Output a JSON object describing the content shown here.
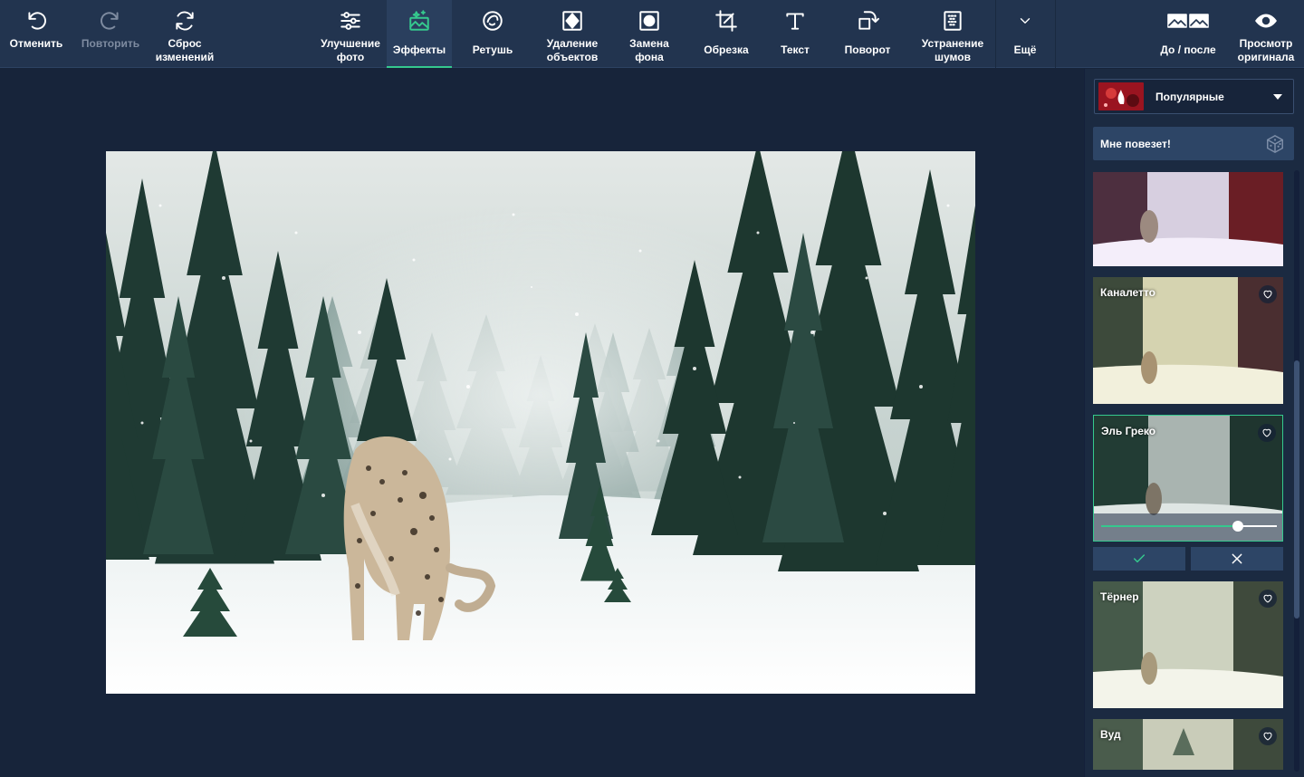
{
  "toolbar": {
    "undo": "Отменить",
    "redo": "Повторить",
    "reset": "Сброс\nизменений",
    "enhance": "Улучшение\nфото",
    "effects": "Эффекты",
    "retouch": "Ретушь",
    "remove_objects": "Удаление\nобъектов",
    "replace_bg": "Замена\nфона",
    "crop": "Обрезка",
    "text": "Текст",
    "rotate": "Поворот",
    "denoise": "Устранение\nшумов",
    "more": "Ещё",
    "before_after": "До / после",
    "view_original": "Просмотр\nоригинала"
  },
  "panel": {
    "category": "Популярные",
    "lucky": "Мне повезет!",
    "effects": [
      {
        "name": ""
      },
      {
        "name": "Каналетто"
      },
      {
        "name": "Эль Греко",
        "selected": true,
        "intensity": 0.78
      },
      {
        "name": "Тёрнер"
      },
      {
        "name": "Вуд"
      }
    ]
  },
  "colors": {
    "accent": "#35c98e",
    "toolbar_bg": "#22344f",
    "workspace_bg": "#17243a",
    "panel_bg": "#1b2a41"
  }
}
